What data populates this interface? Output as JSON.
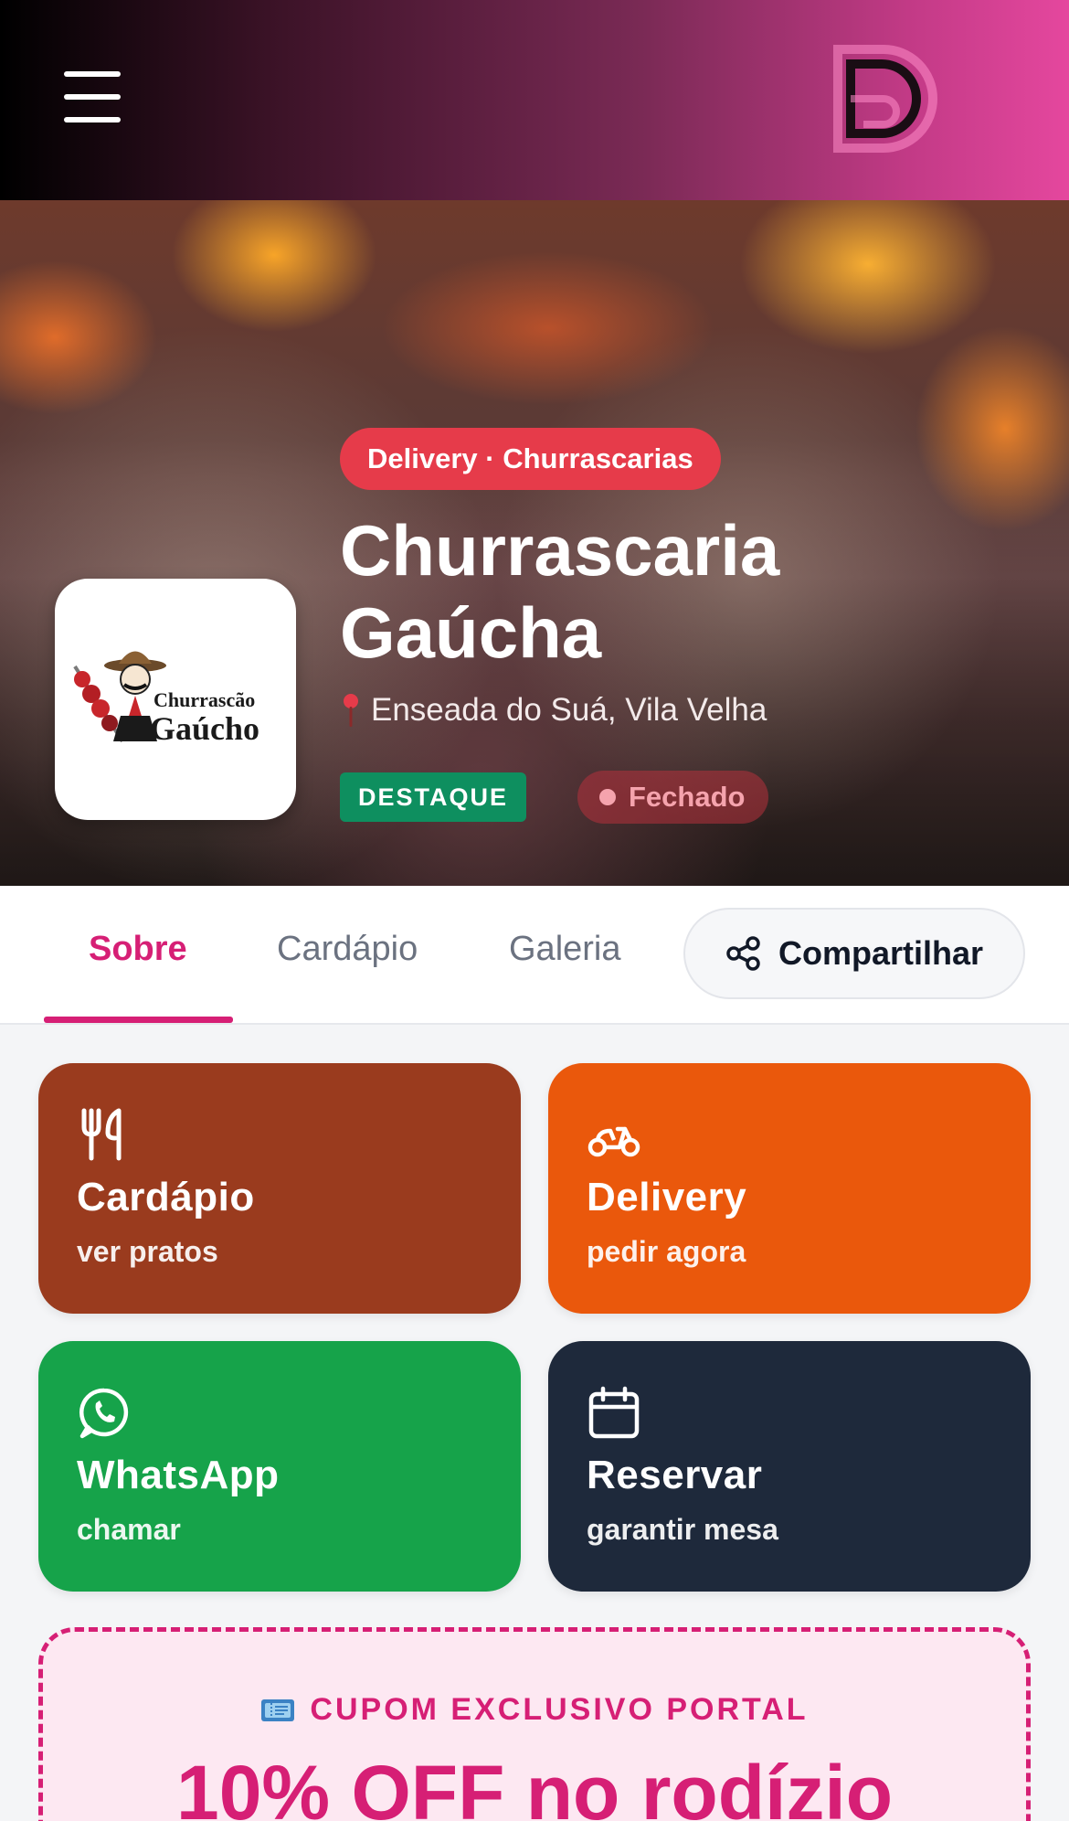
{
  "header": {
    "menu_icon": "hamburger-menu-icon",
    "brand_icon": "d-logo"
  },
  "hero": {
    "category": "Delivery · Churrascarias",
    "name": "Churrascaria Gaúcha",
    "location": "Enseada do Suá, Vila Velha",
    "badge": "DESTAQUE",
    "status": "Fechado",
    "logo_text_top": "Churrascão",
    "logo_text_bottom": "Gaúcho"
  },
  "tabs": {
    "items": [
      {
        "label": "Sobre",
        "active": true
      },
      {
        "label": "Cardápio",
        "active": false
      },
      {
        "label": "Galeria",
        "active": false
      }
    ],
    "share_label": "Compartilhar"
  },
  "actions": [
    {
      "title": "Cardápio",
      "subtitle": "ver pratos",
      "icon": "utensils-icon",
      "color": "#9a3b1e"
    },
    {
      "title": "Delivery",
      "subtitle": "pedir agora",
      "icon": "scooter-icon",
      "color": "#ea580c"
    },
    {
      "title": "WhatsApp",
      "subtitle": "chamar",
      "icon": "whatsapp-icon",
      "color": "#16a34a"
    },
    {
      "title": "Reservar",
      "subtitle": "garantir mesa",
      "icon": "calendar-icon",
      "color": "#1e293b"
    }
  ],
  "coupon": {
    "label": "CUPOM EXCLUSIVO PORTAL",
    "offer": "10% OFF no rodízio",
    "accent": "#d61f75"
  }
}
